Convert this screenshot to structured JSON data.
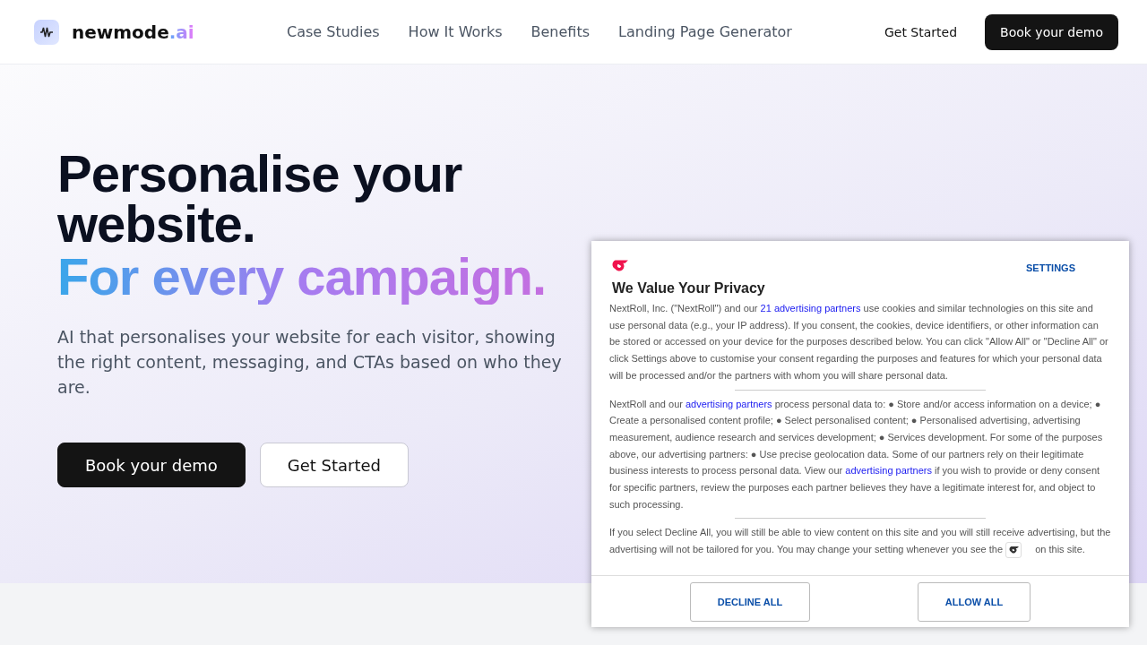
{
  "brand": {
    "name": "newmode",
    "suffix": ".ai"
  },
  "nav": [
    "Case Studies",
    "How It Works",
    "Benefits",
    "Landing Page Generator"
  ],
  "header_actions": [
    {
      "kind": "link",
      "label": "Get Started"
    },
    {
      "kind": "primary",
      "label": "Book your demo"
    }
  ],
  "hero": {
    "title": "Personalise your website.",
    "accent": "For every campaign.",
    "subtitle": "AI that personalises your website for each visitor, showing the right content, messaging, and CTAs based on who they are.",
    "buttons": [
      {
        "kind": "primary",
        "label": "Book your demo"
      },
      {
        "kind": "secondary",
        "label": "Get Started"
      }
    ]
  },
  "consent": {
    "settings": "SETTINGS",
    "title": "We Value Your Privacy",
    "paragraphs": [
      [
        {
          "kind": "text",
          "text": "NextRoll, Inc. (\"NextRoll\") and our "
        },
        {
          "kind": "link",
          "text": "21 advertising partners"
        },
        {
          "kind": "text",
          "text": " use cookies and similar technologies on this site and use personal data (e.g., your IP address). If you consent, the cookies, device identifiers, or other information can be stored or accessed on your device for the purposes described below. You can click \"Allow All\" or \"Decline All\" or click Settings above to customise your consent regarding the purposes and features for which your personal data will be processed and/or the partners with whom you will share personal data."
        }
      ],
      [
        {
          "kind": "text",
          "text": "NextRoll and our "
        },
        {
          "kind": "link",
          "text": "advertising partners"
        },
        {
          "kind": "text",
          "text": " process personal data to: ● Store and/or access information on a device; ● Create a personalised content profile; ● Select personalised content; ● Personalised advertising, advertising measurement, audience research and services development; ● Services development. For some of the purposes above, our advertising partners: ● Use precise geolocation data. Some of our partners rely on their legitimate business interests to process personal data. View our "
        },
        {
          "kind": "link",
          "text": "advertising partners"
        },
        {
          "kind": "text",
          "text": " if you wish to provide or deny consent for specific partners, review the purposes each partner believes they have a legitimate interest for, and object to such processing."
        }
      ],
      [
        {
          "kind": "text",
          "text": "If you select Decline All, you will still be able to view content on this site and you will still receive advertising, but the advertising will not be tailored for you. You may change your setting whenever you see the "
        },
        {
          "kind": "icon"
        },
        {
          "kind": "text",
          "text": " on this site."
        }
      ]
    ],
    "buttons": [
      "DECLINE ALL",
      "ALLOW ALL"
    ]
  }
}
